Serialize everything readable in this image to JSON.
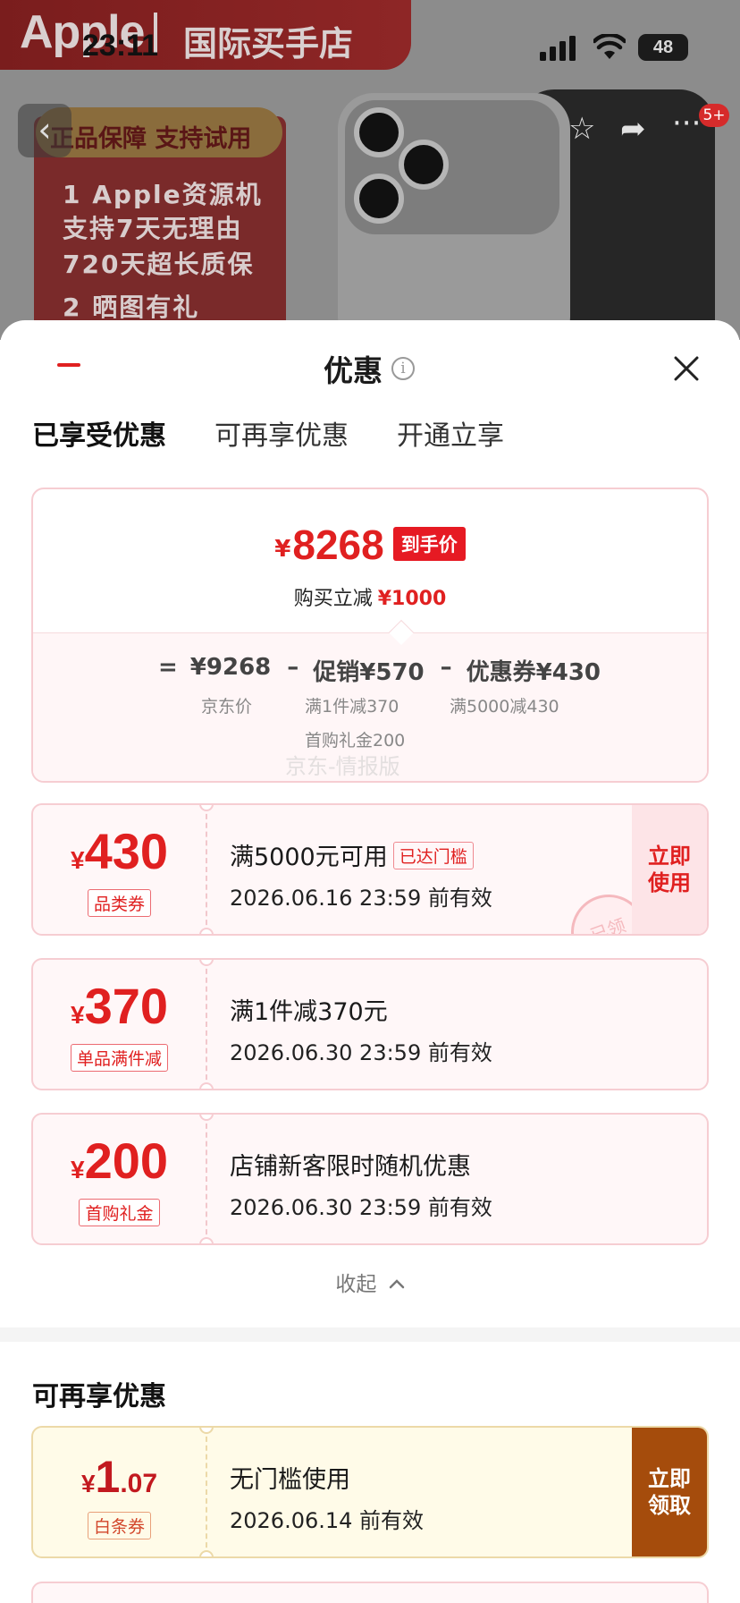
{
  "background": {
    "banner_brand": "Apple",
    "banner_store": "国际买手店",
    "left_tag": "正品保障  支持试用",
    "left_lines": [
      "1 Apple资源机",
      "支持7天无理由",
      "720天超长质保",
      "2 晒图有礼"
    ],
    "cart_badge": "5+"
  },
  "status_bar": {
    "time": "23:11",
    "battery": "48"
  },
  "sheet": {
    "title": "优惠",
    "tabs": [
      "已享受优惠",
      "可再享优惠",
      "开通立享"
    ],
    "summary": {
      "yen": "¥",
      "final_price": "8268",
      "final_tag": "到手价",
      "reduce_label": "购买立减",
      "reduce_value": "¥1000",
      "formula": {
        "equals": "=",
        "base": "¥9268",
        "minus1": "–",
        "promo": "促销¥570",
        "minus2": "–",
        "coupon": "优惠券¥430"
      },
      "base_label": "京东价",
      "promo_sub1": "满1件减370",
      "promo_sub2": "首购礼金200",
      "coupon_sub": "满5000减430",
      "watermark": "京东-情报版"
    },
    "coupons": [
      {
        "yen": "¥",
        "amount": "430",
        "tag": "品类券",
        "title": "满5000元可用",
        "threshold": "已达门槛",
        "date": "2026.06.16 23:59 前有效",
        "action": "立即使用",
        "stamp": "已领"
      },
      {
        "yen": "¥",
        "amount": "370",
        "tag": "单品满件减",
        "title": "满1件减370元",
        "date": "2026.06.30 23:59 前有效"
      },
      {
        "yen": "¥",
        "amount": "200",
        "tag": "首购礼金",
        "title": "店铺新客限时随机优惠",
        "date": "2026.06.30 23:59 前有效"
      }
    ],
    "collapse_label": "收起",
    "more_section_title": "可再享优惠",
    "more_coupons": [
      {
        "yen": "¥",
        "amount_int": "1",
        "amount_dec": ".07",
        "tag": "白条券",
        "title": "无门槛使用",
        "date": "2026.06.14 前有效",
        "action": "立即领取"
      }
    ]
  },
  "colors": {
    "accent_red": "#e02020",
    "claim_brown": "#a54c0c"
  }
}
